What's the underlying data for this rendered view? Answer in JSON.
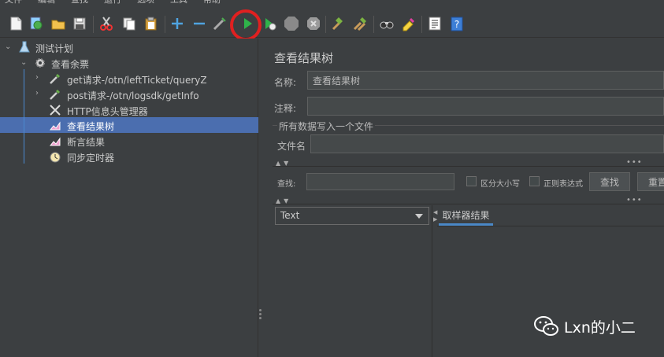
{
  "menubar": {
    "items": [
      "文件",
      "编辑",
      "查找",
      "运行",
      "选项",
      "工具",
      "帮助"
    ]
  },
  "toolbar": {
    "buttons": [
      {
        "name": "new-icon",
        "tooltip": ""
      },
      {
        "name": "templates-icon"
      },
      {
        "name": "open-icon"
      },
      {
        "name": "save-icon"
      },
      {
        "name": "cut-icon"
      },
      {
        "name": "copy-icon"
      },
      {
        "name": "paste-icon"
      },
      {
        "name": "expand-icon"
      },
      {
        "name": "collapse-icon"
      },
      {
        "name": "toggle-icon"
      },
      {
        "name": "start-icon"
      },
      {
        "name": "start-no-pause-icon"
      },
      {
        "name": "stop-icon"
      },
      {
        "name": "shutdown-icon"
      },
      {
        "name": "clear-icon"
      },
      {
        "name": "clear-all-icon"
      },
      {
        "name": "search-icon"
      },
      {
        "name": "reset-search-icon"
      },
      {
        "name": "function-helper-icon"
      },
      {
        "name": "help-icon"
      }
    ],
    "help_glyph": "?"
  },
  "tree": {
    "items": [
      {
        "label": "测试计划"
      },
      {
        "label": "查看余票"
      },
      {
        "label": "get请求-/otn/leftTicket/queryZ"
      },
      {
        "label": "post请求-/otn/logsdk/getInfo"
      },
      {
        "label": "HTTP信息头管理器"
      },
      {
        "label": "查看结果树"
      },
      {
        "label": "断言结果"
      },
      {
        "label": "同步定时器"
      }
    ]
  },
  "panel": {
    "title": "查看结果树",
    "name_label": "名称:",
    "name_value": "查看结果树",
    "comment_label": "注释:",
    "comment_value": "",
    "fieldset_title": "所有数据写入一个文件",
    "filename_label": "文件名",
    "filename_value": "",
    "search_label": "查找:",
    "search_value": "",
    "case_sensitive_label": "区分大小写",
    "regex_label": "正则表达式",
    "search_button": "查找",
    "reset_button": "重置",
    "renderer_selected": "Text",
    "tab_label": "取样器结果"
  },
  "watermark": {
    "text": "Lxn的小二"
  },
  "colors": {
    "background": "#3c3f41",
    "selection": "#4b6eaf",
    "accent_tab": "#4a88c7",
    "highlight_circle": "#e02020",
    "run_green": "#2fb34a"
  }
}
